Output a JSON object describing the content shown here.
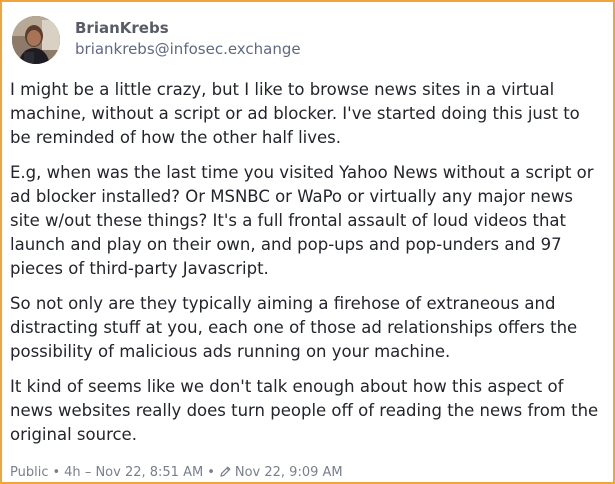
{
  "author": {
    "display_name": "BrianKrebs",
    "handle": "briankrebs@infosec.exchange",
    "avatar_icon": "user-avatar"
  },
  "content": {
    "paragraphs": [
      "I might be a little crazy, but I like to browse news sites in a virtual machine, without a script or ad blocker. I've started doing this just to be reminded of how the other half lives.",
      "E.g, when was the last time you visited Yahoo News without a script or ad blocker installed? Or MSNBC or WaPo or virtually any major news site w/out these things? It's a full frontal assault of loud videos that launch and play on their own, and pop-ups and pop-unders and 97 pieces of third-party Javascript.",
      "So not only are they typically aiming a firehose of extraneous and distracting stuff at you, each one of those ad relationships offers the possibility of malicious ads running on your machine.",
      "It kind of seems like we don't talk enough about how this aspect of news websites really does turn people off of reading the news from the original source."
    ]
  },
  "meta": {
    "visibility": "Public",
    "separator": "•",
    "relative_time": "4h",
    "dash": "–",
    "timestamp": "Nov 22, 8:51 AM",
    "edited_timestamp": "Nov 22, 9:09 AM",
    "edit_icon": "pencil-icon"
  },
  "colors": {
    "border": "#f0a43c",
    "text": "#22252c",
    "muted": "#7a7f8e"
  }
}
